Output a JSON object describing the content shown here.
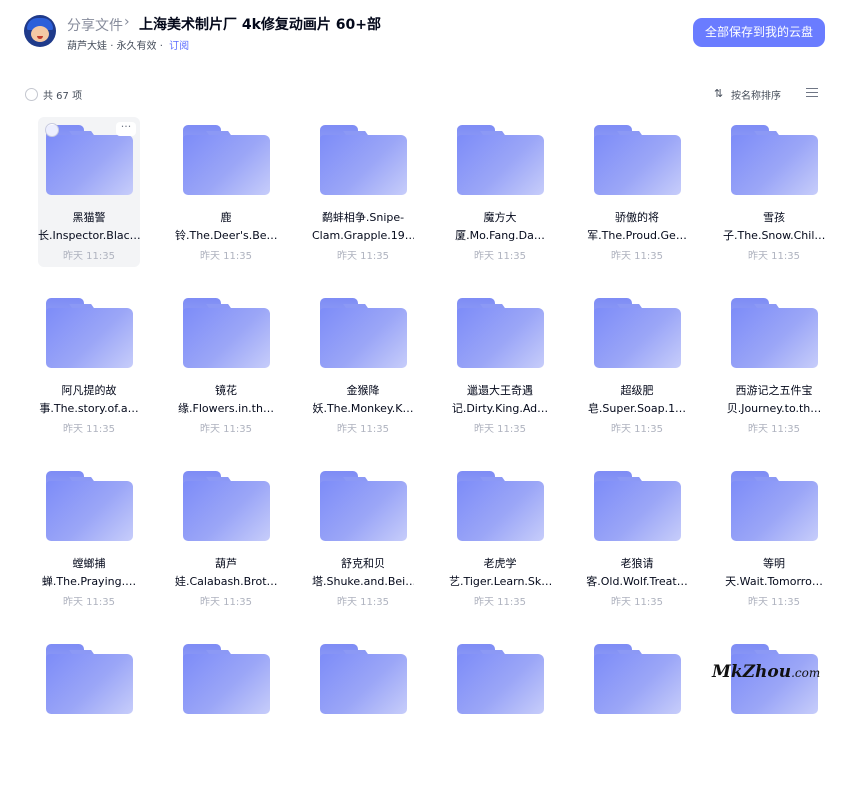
{
  "header": {
    "breadcrumb_root": "分享文件",
    "breadcrumb_sep": "›",
    "title": "上海美术制片厂 4k修复动画片 60+部",
    "owner": "葫芦大娃",
    "validity": "· 永久有效 ·",
    "subscribe": "订阅",
    "save_all": "全部保存到我的云盘"
  },
  "toolbar": {
    "count": "共 67 项",
    "sort_icon": "⇅",
    "sort_label": "按名称排序"
  },
  "files": [
    {
      "line1": "黑猫警",
      "line2": "长.Inspector.Blac…",
      "date": "昨天 11:35"
    },
    {
      "line1": "鹿",
      "line2": "铃.The.Deer's.Be…",
      "date": "昨天 11:35"
    },
    {
      "line1": "鹬蚌相争.Snipe-",
      "line2": "Clam.Grapple.19…",
      "date": "昨天 11:35"
    },
    {
      "line1": "魔方大",
      "line2": "厦.Mo.Fang.Da…",
      "date": "昨天 11:35"
    },
    {
      "line1": "骄傲的将",
      "line2": "军.The.Proud.Ge…",
      "date": "昨天 11:35"
    },
    {
      "line1": "雪孩",
      "line2": "子.The.Snow.Chil…",
      "date": "昨天 11:35"
    },
    {
      "line1": "阿凡提的故",
      "line2": "事.The.story.of.a…",
      "date": "昨天 11:35"
    },
    {
      "line1": "镜花",
      "line2": "缘.Flowers.in.th…",
      "date": "昨天 11:35"
    },
    {
      "line1": "金猴降",
      "line2": "妖.The.Monkey.K…",
      "date": "昨天 11:35"
    },
    {
      "line1": "邋遢大王奇遇",
      "line2": "记.Dirty.King.Ad…",
      "date": "昨天 11:35"
    },
    {
      "line1": "超级肥",
      "line2": "皂.Super.Soap.1…",
      "date": "昨天 11:35"
    },
    {
      "line1": "西游记之五件宝",
      "line2": "贝.Journey.to.th…",
      "date": "昨天 11:35"
    },
    {
      "line1": "螳螂捕",
      "line2": "蝉.The.Praying.…",
      "date": "昨天 11:35"
    },
    {
      "line1": "葫芦",
      "line2": "娃.Calabash.Brot…",
      "date": "昨天 11:35"
    },
    {
      "line1": "舒克和贝",
      "line2": "塔.Shuke.and.Bei…",
      "date": "昨天 11:35"
    },
    {
      "line1": "老虎学",
      "line2": "艺.Tiger.Learn.Sk…",
      "date": "昨天 11:35"
    },
    {
      "line1": "老狼请",
      "line2": "客.Old.Wolf.Treat…",
      "date": "昨天 11:35"
    },
    {
      "line1": "等明",
      "line2": "天.Wait.Tomorro…",
      "date": "昨天 11:35"
    },
    {
      "line1": "",
      "line2": "",
      "date": ""
    },
    {
      "line1": "",
      "line2": "",
      "date": ""
    },
    {
      "line1": "",
      "line2": "",
      "date": ""
    },
    {
      "line1": "",
      "line2": "",
      "date": ""
    },
    {
      "line1": "",
      "line2": "",
      "date": ""
    },
    {
      "line1": "",
      "line2": "",
      "date": ""
    }
  ],
  "watermark": {
    "text": "MkZhou",
    "suffix": ".com"
  },
  "colors": {
    "primary": "#6a7cff",
    "folder": "#8c99f5",
    "muted": "#afb3bf"
  }
}
